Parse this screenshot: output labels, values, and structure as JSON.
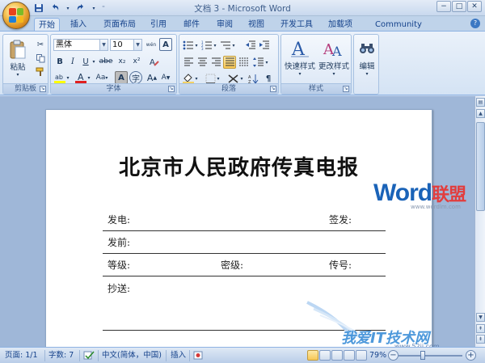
{
  "window": {
    "title": "文档 3 - Microsoft Word",
    "minimize": "−",
    "maximize": "□",
    "close": "✕"
  },
  "qat": {
    "save_icon": "save-icon",
    "undo_icon": "undo-icon",
    "redo_icon": "redo-icon"
  },
  "tabs": [
    {
      "label": "开始",
      "active": true
    },
    {
      "label": "插入"
    },
    {
      "label": "页面布局"
    },
    {
      "label": "引用"
    },
    {
      "label": "邮件"
    },
    {
      "label": "审阅"
    },
    {
      "label": "视图"
    },
    {
      "label": "开发工具"
    },
    {
      "label": "加载项"
    },
    {
      "label": "Community Clips"
    }
  ],
  "ribbon": {
    "clipboard": {
      "label": "剪贴板",
      "paste": "粘贴"
    },
    "font": {
      "label": "字体",
      "font_name": "黑体",
      "font_size": "10",
      "wen": "wén",
      "bold": "B",
      "italic": "I",
      "underline": "U",
      "strike": "abe",
      "subscript": "x₂",
      "superscript": "x²",
      "aa": "Aa",
      "grow": "A",
      "shrink": "A"
    },
    "paragraph": {
      "label": "段落"
    },
    "styles": {
      "label": "样式",
      "quick": "快速样式",
      "change": "更改样式"
    },
    "editing": {
      "label": "编辑"
    }
  },
  "document": {
    "title": "北京市人民政府传真电报",
    "fields": {
      "fa_dian": "发电:",
      "qian_fa": "签发:",
      "fa_qian": "发前:",
      "deng_ji": "等级:",
      "mi_ji": "密级:",
      "chuan_hao": "传号:",
      "chao_song": "抄送:"
    },
    "watermark": {
      "word": "Word",
      "cn": "联盟",
      "url": "www.wordlm.com"
    },
    "watermark2": {
      "text": "我爱IT技术网",
      "url": "www.52ij.com"
    }
  },
  "statusbar": {
    "page": "页面: 1/1",
    "words": "字数: 7",
    "lang": "中文(简体，中国)",
    "insert": "插入",
    "zoom": "79%",
    "zoom_level": 0.79
  },
  "colors": {
    "ribbon_bg": "#dae6f5",
    "workspace_bg": "#9fb7d8",
    "accent": "#15428b"
  }
}
